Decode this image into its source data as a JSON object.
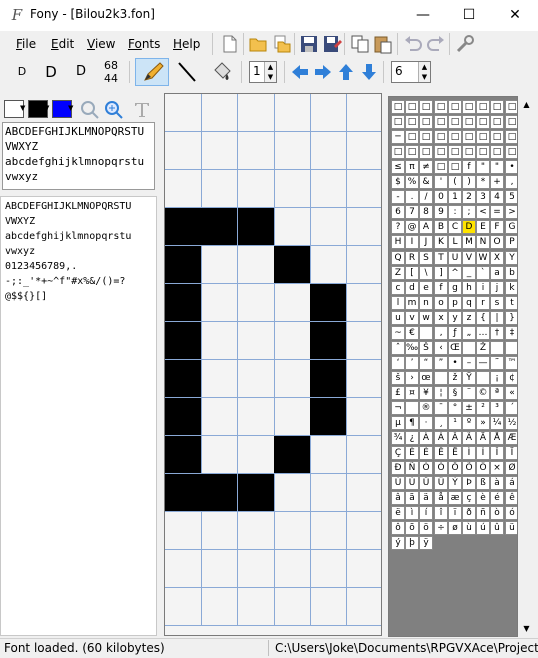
{
  "window": {
    "title": "Fony - [Bilou2k3.fon]",
    "app_icon_glyph": "F",
    "min_glyph": "—",
    "max_glyph": "☐",
    "close_glyph": "✕"
  },
  "menu": {
    "items": [
      {
        "key": "F",
        "rest": "ile"
      },
      {
        "key": "E",
        "rest": "dit"
      },
      {
        "key": "V",
        "rest": "iew"
      },
      {
        "key": "Fo",
        "rest": "nts"
      },
      {
        "key": "H",
        "rest": "elp"
      }
    ]
  },
  "toolbar": {
    "view_buttons": [
      "D",
      "D",
      "D"
    ],
    "size_info": {
      "top": "68",
      "bottom": "44"
    },
    "zoom_value": "1",
    "char_step_value": "6",
    "icons": [
      "new-file-icon",
      "open-folder-icon",
      "open-multiple-icon",
      "save-icon",
      "save-as-icon",
      "copy-icon",
      "paste-icon",
      "undo-icon",
      "redo-icon",
      "settings-wrench-icon"
    ]
  },
  "left_panel": {
    "sample_top": [
      "ABCDEFGHIJKLMNOPQRSTU",
      "VWXYZ",
      "abcdefghijklmnopqrstu",
      "vwxyz"
    ],
    "sample_bottom": [
      "ABCDEFGHIJKLMNOPQRSTU",
      "VWXYZ",
      "abcdefghijklmnopqrstu",
      "vwxyz",
      "0123456789,.",
      "-;:_'*+~^f\"#x%&/()=?",
      "@$${}[]"
    ],
    "colors": {
      "fg": "#ffffff",
      "bg": "#000000",
      "grid": "#0000ff"
    }
  },
  "editor": {
    "columns": 6,
    "rows": 14,
    "pixels": [
      "......",
      "......",
      "......",
      "...",
      "X..X..",
      "X.....",
      "X.....",
      "X.....",
      "X.....",
      "X.....",
      "X.....",
      "XXX...",
      "......",
      "......"
    ],
    "glyph_rows": [
      "000000",
      "000000",
      "000000",
      "111000",
      "100100",
      "100010",
      "100010",
      "100010",
      "100010",
      "100100",
      "111000",
      "000000",
      "000000",
      "000000"
    ]
  },
  "charmap": {
    "columns": 9,
    "selected": "D",
    "chars": [
      "□",
      "□",
      "□",
      "□",
      "□",
      "□",
      "□",
      "□",
      "□",
      "□",
      "□",
      "□",
      "□",
      "□",
      "□",
      "□",
      "□",
      "□",
      "─",
      "□",
      "□",
      "□",
      "□",
      "□",
      "□",
      "□",
      "□",
      "□",
      "□",
      "□",
      "□",
      "□",
      "□",
      "□",
      "□",
      "□",
      "≤",
      "π",
      "≠",
      "□",
      "□",
      "f",
      "\"",
      "\"",
      "•",
      "$",
      "%",
      "&",
      "'",
      "(",
      ")",
      "*",
      "+",
      ",",
      "-",
      ".",
      "/",
      "0",
      "1",
      "2",
      "3",
      "4",
      "5",
      "6",
      "7",
      "8",
      "9",
      ":",
      ";",
      "<",
      "=",
      ">",
      "?",
      "@",
      "A",
      "B",
      "C",
      "D",
      "E",
      "F",
      "G",
      "H",
      "I",
      "J",
      "K",
      "L",
      "M",
      "N",
      "O",
      "P",
      "Q",
      "R",
      "S",
      "T",
      "U",
      "V",
      "W",
      "X",
      "Y",
      "Z",
      "[",
      "\\",
      "]",
      "^",
      "_",
      "`",
      "a",
      "b",
      "c",
      "d",
      "e",
      "f",
      "g",
      "h",
      "i",
      "j",
      "k",
      "l",
      "m",
      "n",
      "o",
      "p",
      "q",
      "r",
      "s",
      "t",
      "u",
      "v",
      "w",
      "x",
      "y",
      "z",
      "{",
      "|",
      "}",
      "~",
      "€",
      "",
      "‚",
      "ƒ",
      "„",
      "…",
      "†",
      "‡",
      "ˆ",
      "‰",
      "Š",
      "‹",
      "Œ",
      "",
      "Ž",
      "",
      "",
      "‘",
      "’",
      "“",
      "”",
      "•",
      "–",
      "—",
      "˜",
      "™",
      "š",
      "›",
      "œ",
      "",
      "ž",
      "Ÿ",
      "",
      "¡",
      "¢",
      "£",
      "¤",
      "¥",
      "¦",
      "§",
      "¨",
      "©",
      "ª",
      "«",
      "¬",
      "",
      "®",
      "¯",
      "°",
      "±",
      "²",
      "³",
      "´",
      "µ",
      "¶",
      "·",
      "¸",
      "¹",
      "º",
      "»",
      "¼",
      "½",
      "¾",
      "¿",
      "À",
      "Á",
      "Â",
      "Ã",
      "Ä",
      "Å",
      "Æ",
      "Ç",
      "È",
      "É",
      "Ê",
      "Ë",
      "Ì",
      "Í",
      "Î",
      "Ï",
      "Ð",
      "Ñ",
      "Ò",
      "Ó",
      "Ô",
      "Õ",
      "Ö",
      "×",
      "Ø",
      "Ù",
      "Ú",
      "Û",
      "Ü",
      "Ý",
      "Þ",
      "ß",
      "à",
      "á",
      "â",
      "ã",
      "ä",
      "å",
      "æ",
      "ç",
      "è",
      "é",
      "ê",
      "ë",
      "ì",
      "í",
      "î",
      "ï",
      "ð",
      "ñ",
      "ò",
      "ó",
      "ô",
      "õ",
      "ö",
      "÷",
      "ø",
      "ù",
      "ú",
      "û",
      "ü",
      "ý",
      "þ",
      "ÿ"
    ]
  },
  "status": {
    "left": "Font loaded. (60 kilobytes)",
    "right": "C:\\Users\\Joke\\Documents\\RPGVXAce\\Project4"
  }
}
